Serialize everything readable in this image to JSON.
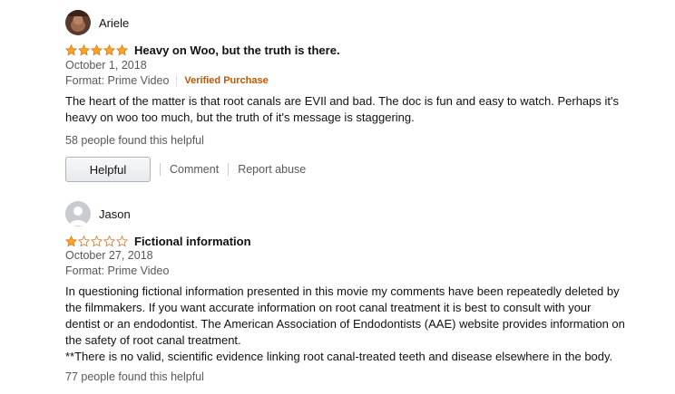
{
  "reviews": [
    {
      "author": "Ariele",
      "rating": 5,
      "title": "Heavy on Woo, but the truth is there.",
      "date": "October 1, 2018",
      "format": "Format: Prime Video",
      "verified": "Verified Purchase",
      "body": "The heart of the matter is that root canals are EVIl and bad. The doc is fun and easy to watch. Perhaps it's heavy on woo too much, but the truth of it's message is staggering.",
      "helpful_count": "58 people found this helpful",
      "helpful_button": "Helpful",
      "comment_link": "Comment",
      "report_link": "Report abuse"
    },
    {
      "author": "Jason",
      "rating": 1,
      "title": "Fictional information",
      "date": "October 27, 2018",
      "format": "Format: Prime Video",
      "body_lines": [
        "In questioning fictional information presented in this movie my comments have been repeatedly deleted by the filmmakers. If you want accurate information on root canal treatment it is best to consult with your dentist or an endodontist. The American Association of Endodontists (AAE) website provides information on the safety of root canal treatment.",
        "**There is no valid, scientific evidence linking root canal-treated teeth and disease elsewhere in the body."
      ],
      "helpful_count": "77 people found this helpful"
    }
  ],
  "colors": {
    "star_fill": "#ffa41c",
    "star_stroke": "#de7921",
    "verified": "#c45500",
    "muted": "#565959"
  }
}
